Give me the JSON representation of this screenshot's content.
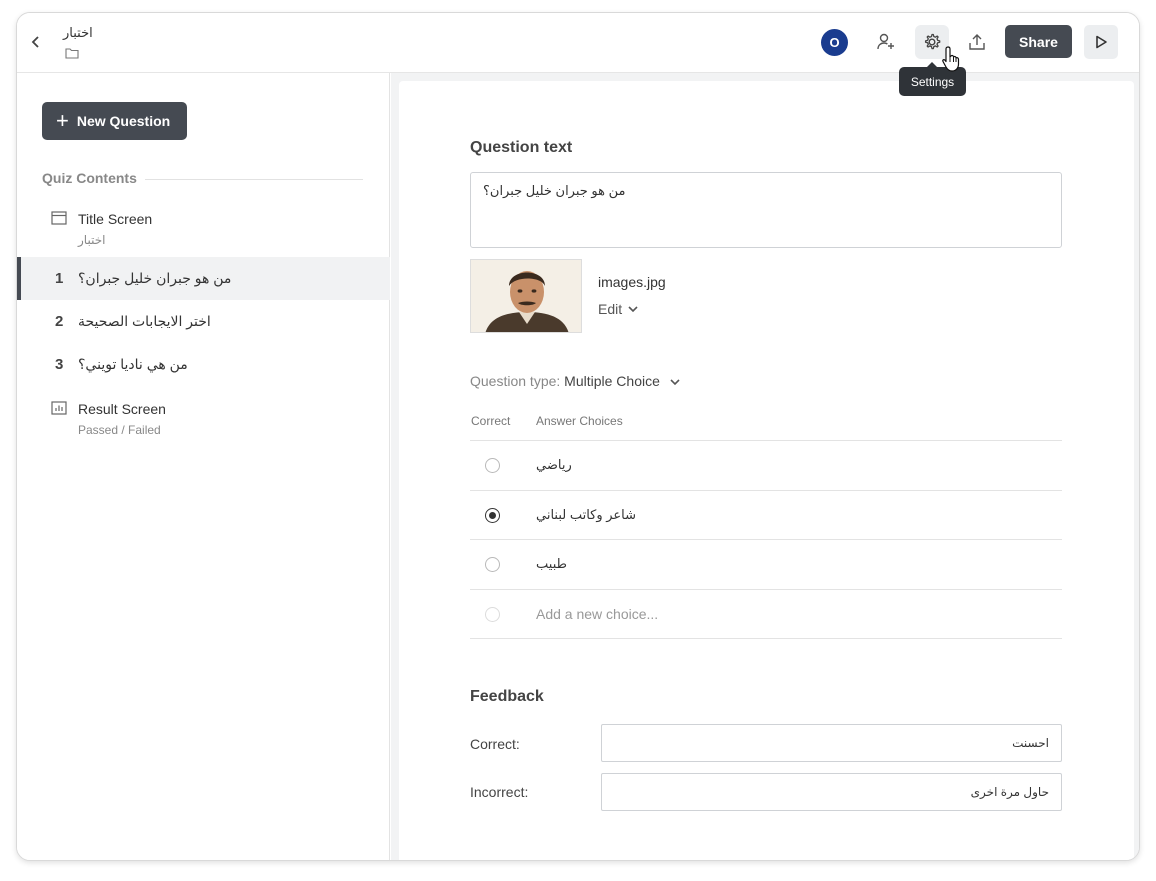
{
  "header": {
    "title": "اختبار",
    "avatar_initial": "O",
    "share_label": "Share",
    "tooltip": "Settings"
  },
  "sidebar": {
    "new_question_label": "New Question",
    "section_title": "Quiz Contents",
    "items": [
      {
        "label": "Title Screen",
        "sub": "اختبار"
      },
      {
        "num": "1",
        "label": "من هو جبران خليل جبران؟"
      },
      {
        "num": "2",
        "label": "اختر الايجابات الصحيحة"
      },
      {
        "num": "3",
        "label": "من هي ناديا تويني؟"
      },
      {
        "label": "Result Screen",
        "sub": "Passed / Failed"
      }
    ]
  },
  "editor": {
    "question_heading": "Question text",
    "question_value": "من هو جبران خليل جبران؟",
    "image_name": "images.jpg",
    "edit_label": "Edit",
    "question_type_label": "Question type:",
    "question_type_value": "Multiple Choice",
    "col_correct": "Correct",
    "col_answers": "Answer Choices",
    "choices": [
      {
        "text": "رياضي",
        "correct": false
      },
      {
        "text": "شاعر وكاتب لبناني",
        "correct": true
      },
      {
        "text": "طبيب",
        "correct": false
      }
    ],
    "add_choice_placeholder": "Add a new choice...",
    "feedback_heading": "Feedback",
    "feedback_correct_label": "Correct:",
    "feedback_correct_value": "احسنت",
    "feedback_incorrect_label": "Incorrect:",
    "feedback_incorrect_value": "حاول مرة اخرى"
  }
}
